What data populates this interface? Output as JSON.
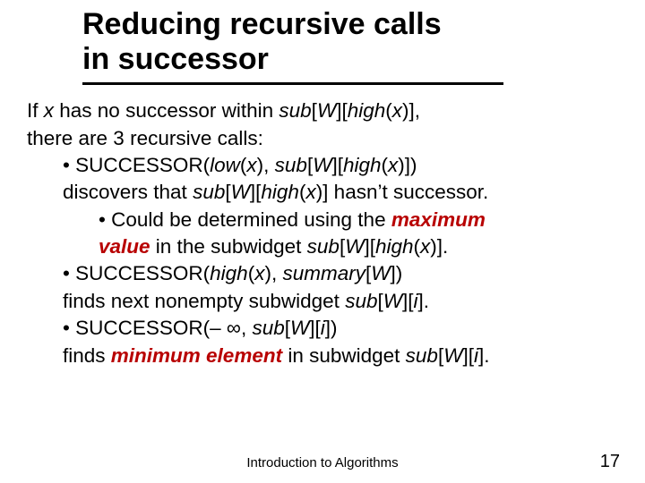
{
  "title_l1": "Reducing recursive calls",
  "title_l2": "in successor",
  "l1a": "If ",
  "l1b": "x",
  "l1c": " has no successor within ",
  "l1d": "sub",
  "l1e": "[",
  "l1f": "W",
  "l1g": "][",
  "l1h": "high",
  "l1i": "(",
  "l1j": "x",
  "l1k": ")],",
  "l2": "there are 3 recursive calls:",
  "l3a": "• SUCCESSOR(",
  "l3b": "low",
  "l3c": "(",
  "l3d": "x",
  "l3e": "), ",
  "l3f": "sub",
  "l3g": "[",
  "l3h": "W",
  "l3i": "][",
  "l3j": "high",
  "l3k": "(",
  "l3l": "x",
  "l3m": ")])",
  "l4a": "discovers that ",
  "l4b": "sub",
  "l4c": "[",
  "l4d": "W",
  "l4e": "][",
  "l4f": "high",
  "l4g": "(",
  "l4h": "x",
  "l4i": ")] hasn’t successor.",
  "l5a": "• Could be determined using the ",
  "l5b": "maximum",
  "l6a": "value",
  "l6b": " in the subwidget ",
  "l6c": "sub",
  "l6d": "[",
  "l6e": "W",
  "l6f": "][",
  "l6g": "high",
  "l6h": "(",
  "l6i": "x",
  "l6j": ")].",
  "l7a": "• SUCCESSOR(",
  "l7b": "high",
  "l7c": "(",
  "l7d": "x",
  "l7e": "), ",
  "l7f": "summary",
  "l7g": "[",
  "l7h": "W",
  "l7i": "])",
  "l8a": "finds next nonempty subwidget ",
  "l8b": "sub",
  "l8c": "[",
  "l8d": "W",
  "l8e": "][",
  "l8f": "i",
  "l8g": "].",
  "l9a": "• SUCCESSOR(– ∞, ",
  "l9b": "sub",
  "l9c": "[",
  "l9d": "W",
  "l9e": "][",
  "l9f": "i",
  "l9g": "])",
  "l10a": "finds ",
  "l10b": "minimum element",
  "l10c": " in subwidget ",
  "l10d": "sub",
  "l10e": "[",
  "l10f": "W",
  "l10g": "][",
  "l10h": "i",
  "l10i": "].",
  "footer_center": "Introduction to Algorithms",
  "footer_right": "17"
}
